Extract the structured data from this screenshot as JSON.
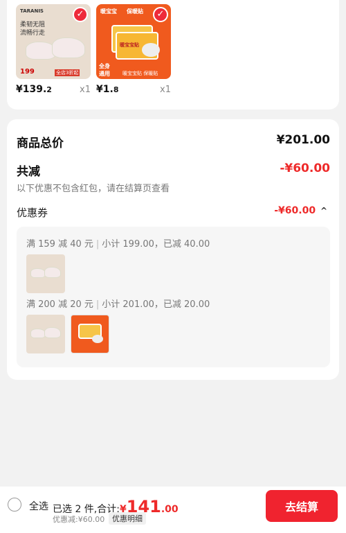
{
  "products": [
    {
      "price_main": "¥139.",
      "price_dec": "2",
      "qty": "x1",
      "art": {
        "brand": "TARANIS",
        "line1": "柔韧无阻",
        "line2": "流畅行走",
        "price": "199",
        "tag": "全店3折起"
      }
    },
    {
      "price_main": "¥1.",
      "price_dec": "8",
      "qty": "x1",
      "art": {
        "top_tag": "暖宝宝",
        "top_tag2": "保暖贴",
        "side": "全身",
        "side2": "通用",
        "bottom": "暖宝宝贴 保暖贴",
        "pack": "暖宝宝贴"
      }
    }
  ],
  "summary": {
    "total_label": "商品总价",
    "total_value": "¥201.00",
    "discount_label": "共减",
    "discount_value": "-¥60.00",
    "note": "以下优惠不包含红包，请在结算页查看",
    "coupon_label": "优惠券",
    "coupon_value": "-¥60.00"
  },
  "coupons": [
    {
      "rule": "满 159 减 40 元",
      "detail": "小计 199.00，已减 40.00"
    },
    {
      "rule": "满 200 减 20 元",
      "detail": "小计 201.00，已减 20.00"
    }
  ],
  "bottom": {
    "select_all": "全选",
    "selected": "已选 2 件,合计:",
    "currency": "¥",
    "total_int": "141",
    "total_dec": ".00",
    "discount_text": "优惠减:¥60.00",
    "detail_label": "优惠明细",
    "checkout_label": "去结算"
  },
  "colors": {
    "accent": "#ee2a2a",
    "checkout": "#f0232f"
  }
}
